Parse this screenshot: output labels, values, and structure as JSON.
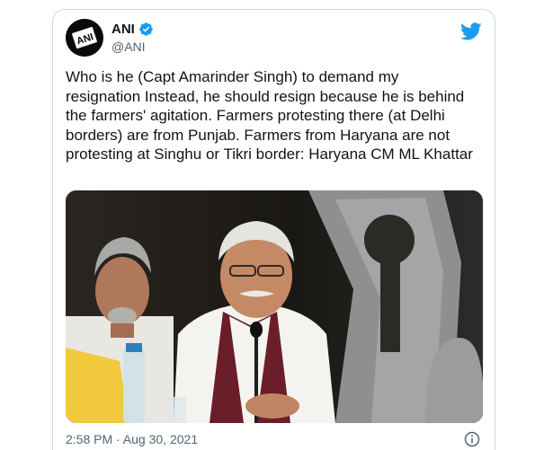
{
  "tweet": {
    "display_name": "ANI",
    "handle": "@ANI",
    "avatar_text": "ANI",
    "text": "Who is he (Capt Amarinder Singh) to demand my resignation Instead, he should resign because he is behind the farmers' agitation. Farmers protesting there (at Delhi borders) are from Punjab. Farmers from Haryana are not protesting at Singhu or Tikri border: Haryana CM ML Khattar",
    "timestamp": "2:58 PM · Aug 30, 2021"
  },
  "icons": {
    "verified": "verified-badge-icon",
    "brand": "twitter-bird-icon",
    "info": "info-icon"
  },
  "colors": {
    "twitter_blue": "#1d9bf0",
    "text_primary": "#0f1419",
    "text_secondary": "#536471",
    "border": "#cfd9de"
  }
}
